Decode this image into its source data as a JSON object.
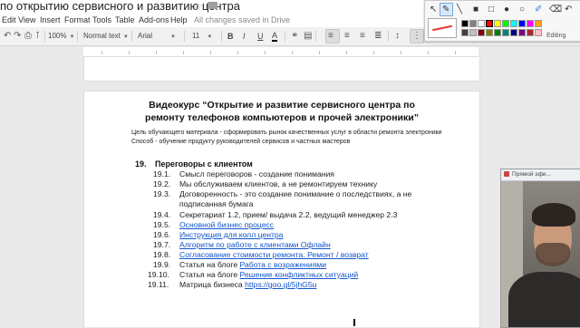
{
  "doc_title": "по открытию сервисного и развитию центра",
  "menu": {
    "items": [
      "Edit",
      "View",
      "Insert",
      "Format",
      "Tools",
      "Table",
      "Add-ons",
      "Help"
    ],
    "saved_status": "All changes saved in Drive"
  },
  "toolbar": {
    "zoom": "100%",
    "style": "Normal text",
    "font": "Arial",
    "size": "11",
    "bold": "B",
    "italic": "I",
    "underline": "U",
    "text_color": "A",
    "editing": "Editing"
  },
  "document": {
    "title_line1": "Видеокурс “Открытие и развитие сервисного центра по",
    "title_line2": "ремонту телефонов компьютеров и прочей электроники”",
    "intro_line1": "Цель обучающего материала - сформировать рынок качественных услуг в области ремонта электроники",
    "intro_line2": "Способ - обучение продукту руководителей сервисов и частных мастеров",
    "section": {
      "number": "19.",
      "title": "Переговоры с клиентом",
      "items": [
        {
          "num": "19.1.",
          "text": "Смысл переговоров - создание понимания"
        },
        {
          "num": "19.2.",
          "text": "Мы обслуживаем клиентов, а не ремонтируем технику"
        },
        {
          "num": "19.3.",
          "text": "Договоренность - это создание понимание о последствиях, а не"
        },
        {
          "num": "",
          "text": "подписанная бумага"
        },
        {
          "num": "19.4.",
          "text": "Секретариат 1.2, прием/ выдача 2.2, ведущий менеджер 2.3"
        },
        {
          "num": "19.5.",
          "link": "Основной бизнес процесс"
        },
        {
          "num": "19.6.",
          "link": "Инструкция для колл центра"
        },
        {
          "num": "19.7.",
          "link": "Алгоритм по работе с клиентами Офлайн"
        },
        {
          "num": "19.8.",
          "link": "Согласование стоимости ремонта. Ремонт / возврат"
        },
        {
          "num": "19.9.",
          "text": "Статья на блоге ",
          "link": "Работа с возражениями"
        },
        {
          "num": "19.10.",
          "text": "Статья на блоге ",
          "link": "Решение конфликтных ситуаций"
        },
        {
          "num": "19.11.",
          "text": "Матрица бизнеса ",
          "link": "https://goo.gl/5jhG5u"
        }
      ]
    }
  },
  "video_window": {
    "title": "Прямой эфи..."
  },
  "drawing_tools": {
    "icons": [
      "pointer-icon",
      "pen-icon",
      "line-icon",
      "filled-rect-icon",
      "rect-icon",
      "filled-ellipse-icon",
      "ellipse-icon",
      "highlighter-icon",
      "eraser-icon",
      "undo-icon"
    ],
    "stroke_color": "#e53935",
    "palette": [
      "#000000",
      "#808080",
      "#ffffff",
      "#ff0000",
      "#ffff00",
      "#00ff00",
      "#00ffff",
      "#0000ff",
      "#ff00ff",
      "#ffa500",
      "#404040",
      "#c0c0c0",
      "#800000",
      "#808000",
      "#008000",
      "#008080",
      "#000080",
      "#800080",
      "#a52a2a",
      "#ffc0cb"
    ]
  }
}
